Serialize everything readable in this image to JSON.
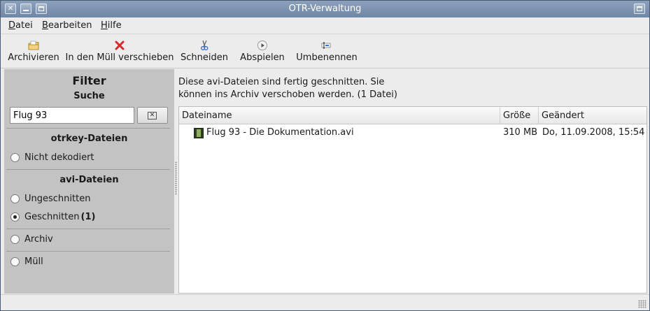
{
  "window": {
    "title": "OTR-Verwaltung"
  },
  "menu": {
    "items": [
      {
        "accel": "D",
        "rest": "atei"
      },
      {
        "accel": "B",
        "rest": "earbeiten"
      },
      {
        "accel": "H",
        "rest": "ilfe"
      }
    ]
  },
  "toolbar": {
    "buttons": [
      {
        "label": "Archivieren",
        "icon": "archive-folder-icon"
      },
      {
        "label": "In den Müll verschieben",
        "icon": "red-x-trash-icon"
      },
      {
        "label": "Schneiden",
        "icon": "scissors-icon"
      },
      {
        "label": "Abspielen",
        "icon": "play-icon"
      },
      {
        "label": "Umbenennen",
        "icon": "rename-icon"
      }
    ]
  },
  "sidebar": {
    "title": "Filter",
    "search_label": "Suche",
    "search_value": "Flug 93",
    "otrkey_heading": "otrkey-Dateien",
    "avi_heading": "avi-Dateien",
    "options": {
      "nicht_dekodiert": "Nicht dekodiert",
      "ungeschnitten": "Ungeschnitten",
      "geschnitten": "Geschnitten",
      "geschnitten_count": "(1)",
      "archiv": "Archiv",
      "muell": "Müll"
    },
    "selected": "geschnitten"
  },
  "main": {
    "info_line1": "Diese avi-Dateien sind fertig geschnitten. Sie",
    "info_line2": "können ins Archiv verschoben werden. (1 Datei)",
    "columns": [
      "Dateiname",
      "Größe",
      "Geändert"
    ],
    "rows": [
      {
        "name": "Flug 93 - Die Dokumentation.avi",
        "size": "310 MB",
        "modified": "Do, 11.09.2008, 15:54",
        "icon": "film-icon"
      }
    ]
  },
  "colors": {
    "titlebar": "#7a90ad",
    "sidebar": "#c3c3c3",
    "window": "#ececec"
  }
}
